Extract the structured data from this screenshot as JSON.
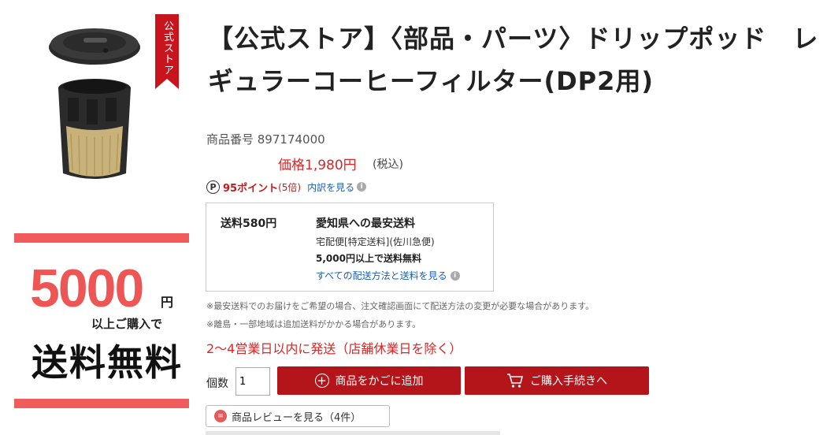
{
  "ribbon": {
    "label": "公式ストア"
  },
  "banner": {
    "amount": "5000",
    "yen": "円",
    "sub": "以上ご購入で",
    "free": "送料無料",
    "color": "#ee5656"
  },
  "product": {
    "title": "【公式ストア】〈部品・パーツ〉ドリップポッド　レギュラーコーヒーフィルター(DP2用)",
    "item_number": "商品番号 897174000",
    "price": "価格1,980円",
    "tax": "(税込)"
  },
  "points": {
    "icon": "P",
    "value": "95ポイント",
    "rate": "(5倍)",
    "link": "内訳を見る"
  },
  "shipping": {
    "fee": "送料580円",
    "heading": "愛知県への最安送料",
    "method": "宅配便[特定送料](佐川急便)",
    "threshold": "5,000円以上で送料無料",
    "link": "すべての配送方法と送料を見る"
  },
  "notes": [
    "※最安送料でのお届けをご希望の場合、注文確認画面にて配送方法の変更が必要な場合があります。",
    "※離島・一部地域は追加送料がかかる場合があります。"
  ],
  "delivery": "2〜4営業日以内に発送（店舗休業日を除く）",
  "quantity": {
    "label": "個数",
    "value": "1"
  },
  "buttons": {
    "add_to_cart": "商品をかごに追加",
    "checkout": "ご購入手続きへ",
    "review": "商品レビューを見る（4件）"
  },
  "colors": {
    "accent": "#b3151b",
    "price": "#d62828",
    "link": "#1d5fb0"
  }
}
